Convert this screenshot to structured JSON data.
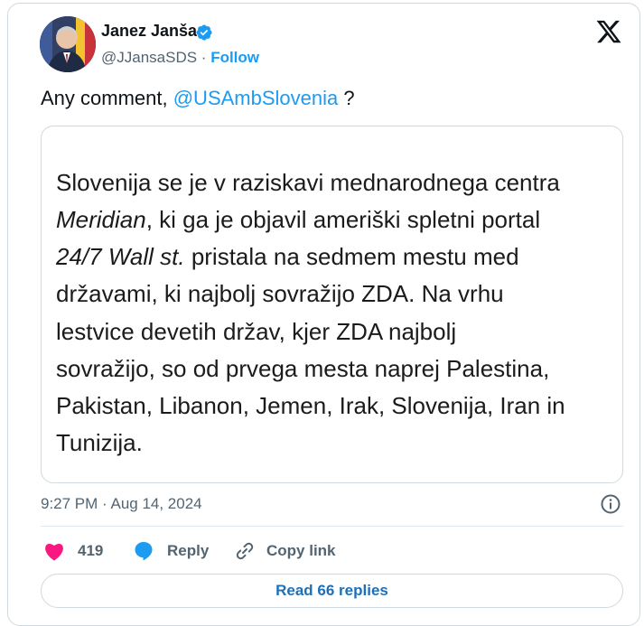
{
  "author": {
    "name": "Janez Janša",
    "handle": "@JJansaSDS",
    "separator": " · ",
    "follow_label": "Follow"
  },
  "tweet": {
    "text_prefix": "Any comment, ",
    "mention": "@USAmbSlovenia",
    "text_suffix": " ?"
  },
  "quote": {
    "lines": [
      {
        "parts": [
          {
            "text": "Slovenija se je v raziskavi mednarodnega centra",
            "italic": false
          }
        ]
      },
      {
        "parts": [
          {
            "text": "Meridian",
            "italic": true
          },
          {
            "text": ", ki ga je objavil ameriški spletni portal",
            "italic": false
          }
        ]
      },
      {
        "parts": [
          {
            "text": "24/7 Wall st.",
            "italic": true
          },
          {
            "text": " pristala na sedmem mestu med",
            "italic": false
          }
        ]
      },
      {
        "parts": [
          {
            "text": "državami, ki najbolj sovražijo ZDA. Na vrhu",
            "italic": false
          }
        ]
      },
      {
        "parts": [
          {
            "text": "lestvice devetih držav, kjer ZDA najbolj",
            "italic": false
          }
        ]
      },
      {
        "parts": [
          {
            "text": "sovražijo, so od prvega mesta naprej Palestina,",
            "italic": false
          }
        ]
      },
      {
        "parts": [
          {
            "text": "Pakistan, Libanon, Jemen, Irak, Slovenija, Iran in",
            "italic": false
          }
        ]
      },
      {
        "parts": [
          {
            "text": "Tunizija.",
            "italic": false
          }
        ]
      }
    ]
  },
  "meta": {
    "timestamp": "9:27 PM · Aug 14, 2024"
  },
  "actions": {
    "like_count": "419",
    "reply_label": "Reply",
    "copy_link_label": "Copy link"
  },
  "read_replies_label": "Read 66 replies",
  "icons": {
    "verified": "verified-badge-icon",
    "x": "x-logo-icon",
    "info": "info-icon",
    "heart": "heart-icon",
    "reply": "reply-bubble-icon",
    "link": "link-icon"
  },
  "colors": {
    "accent": "#1d9bf0",
    "heart": "#f91880",
    "reply_icon": "#1d9bf0",
    "muted": "#536471",
    "border": "#cfd9de"
  }
}
